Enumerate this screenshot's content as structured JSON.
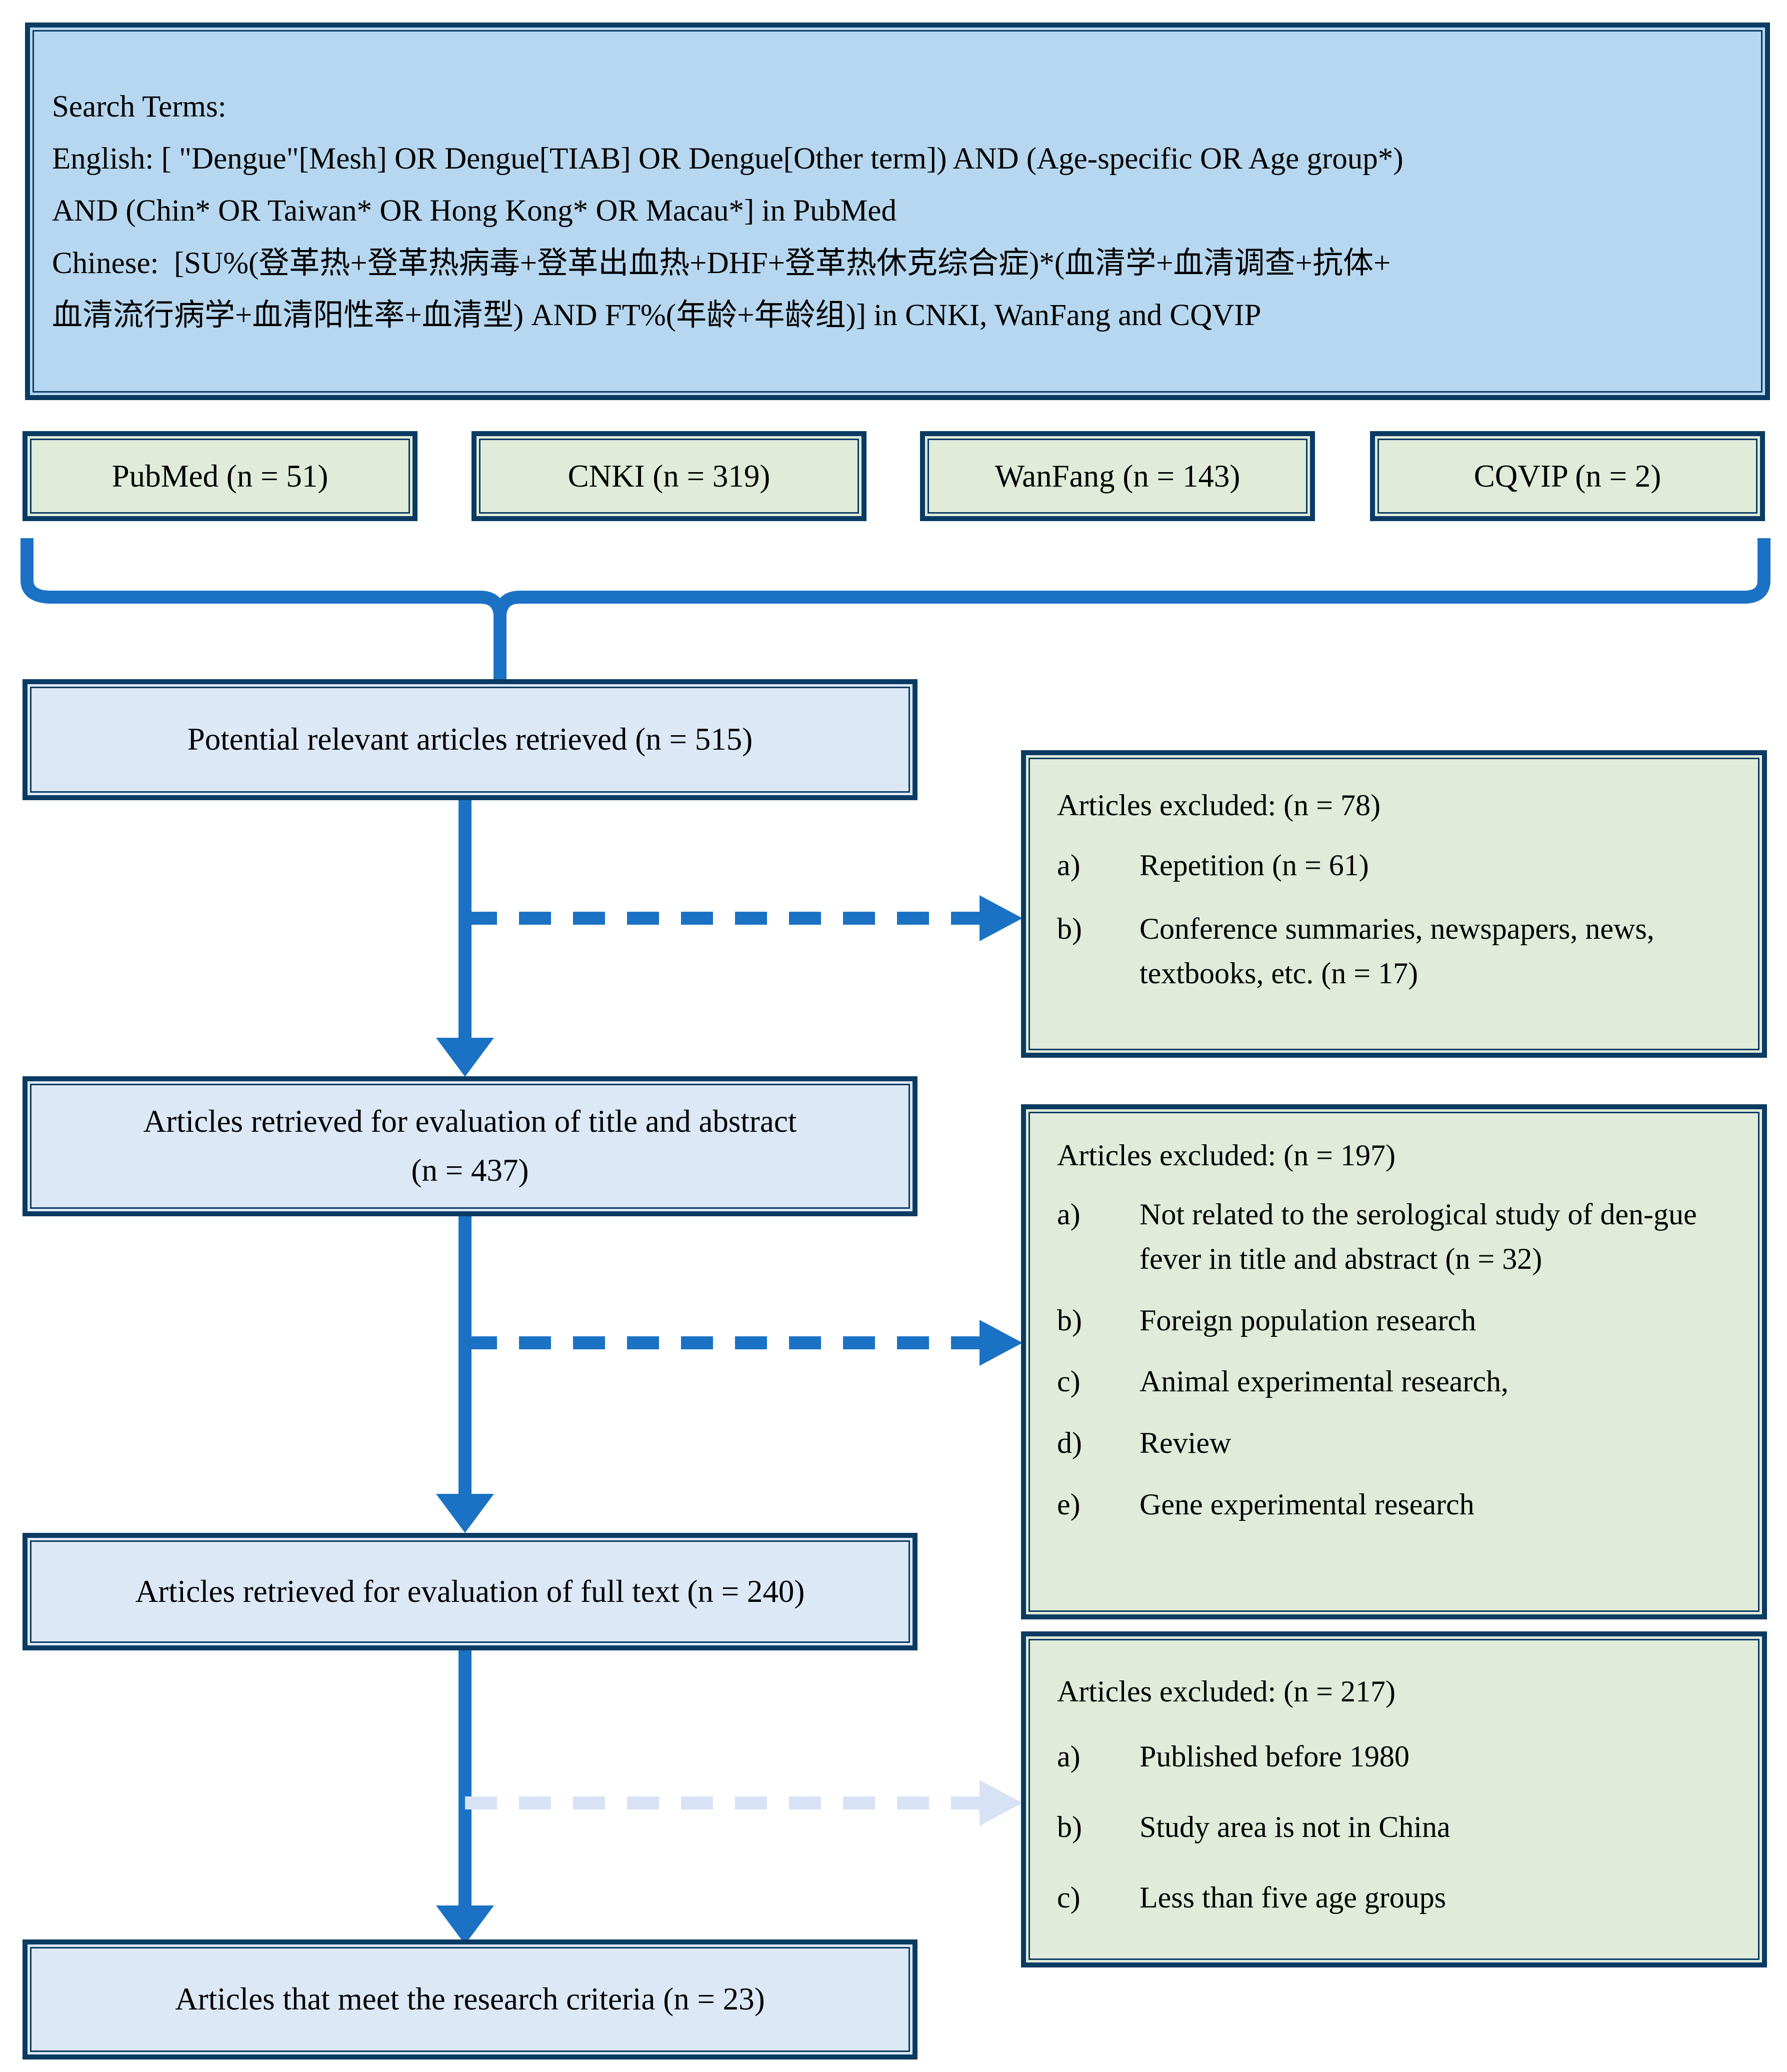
{
  "search_box": {
    "title": "Search Terms:",
    "lines": [
      "English: [ \"Dengue\"[Mesh] OR Dengue[TIAB] OR Dengue[Other term]) AND (Age-specific OR Age group*)",
      "AND (Chin* OR Taiwan* OR Hong Kong* OR Macau*] in PubMed",
      "Chinese:  [SU%(登革热+登革热病毒+登革出血热+DHF+登革热休克综合症)*(血清学+血清调查+抗体+",
      "血清流行病学+血清阳性率+血清型) AND FT%(年龄+年龄组)] in CNKI, WanFang and CQVIP"
    ]
  },
  "databases": [
    {
      "label": "PubMed (n = 51)"
    },
    {
      "label": "CNKI (n = 319)"
    },
    {
      "label": "WanFang (n = 143)"
    },
    {
      "label": "CQVIP (n = 2)"
    }
  ],
  "stages": [
    {
      "line1": "Potential relevant articles retrieved (n = 515)",
      "line2": ""
    },
    {
      "line1": "Articles retrieved for evaluation of title and abstract",
      "line2": "(n = 437)"
    },
    {
      "line1": "Articles retrieved for evaluation of full text (n = 240)",
      "line2": ""
    },
    {
      "line1": "Articles that meet the research criteria (n = 23)",
      "line2": ""
    }
  ],
  "exclusions": [
    {
      "heading": "Articles excluded: (n = 78)",
      "items": [
        {
          "marker": "a)",
          "text": "Repetition (n = 61)"
        },
        {
          "marker": "b)",
          "text": "Conference summaries, newspapers, news, textbooks, etc. (n = 17)"
        }
      ]
    },
    {
      "heading": "Articles excluded: (n = 197)",
      "items": [
        {
          "marker": "a)",
          "text": "Not related to the serological study of den-gue fever in title and abstract (n = 32)"
        },
        {
          "marker": "b)",
          "text": "Foreign population research"
        },
        {
          "marker": "c)",
          "text": "Animal experimental research,"
        },
        {
          "marker": "d)",
          "text": "Review"
        },
        {
          "marker": "e)",
          "text": "Gene experimental research"
        }
      ]
    },
    {
      "heading": "Articles excluded: (n = 217)",
      "items": [
        {
          "marker": "a)",
          "text": "Published before 1980"
        },
        {
          "marker": "b)",
          "text": "Study area is not in China"
        },
        {
          "marker": "c)",
          "text": "Less than five age groups"
        }
      ]
    }
  ],
  "colors": {
    "border_navy": "#0b3b63",
    "fill_blue_strong": "#b6d7ef",
    "fill_blue_light": "#dce8f5",
    "fill_green": "#e0ebd9",
    "connector_blue": "#1b72c4",
    "connector_faded": "#d7e3f4"
  }
}
